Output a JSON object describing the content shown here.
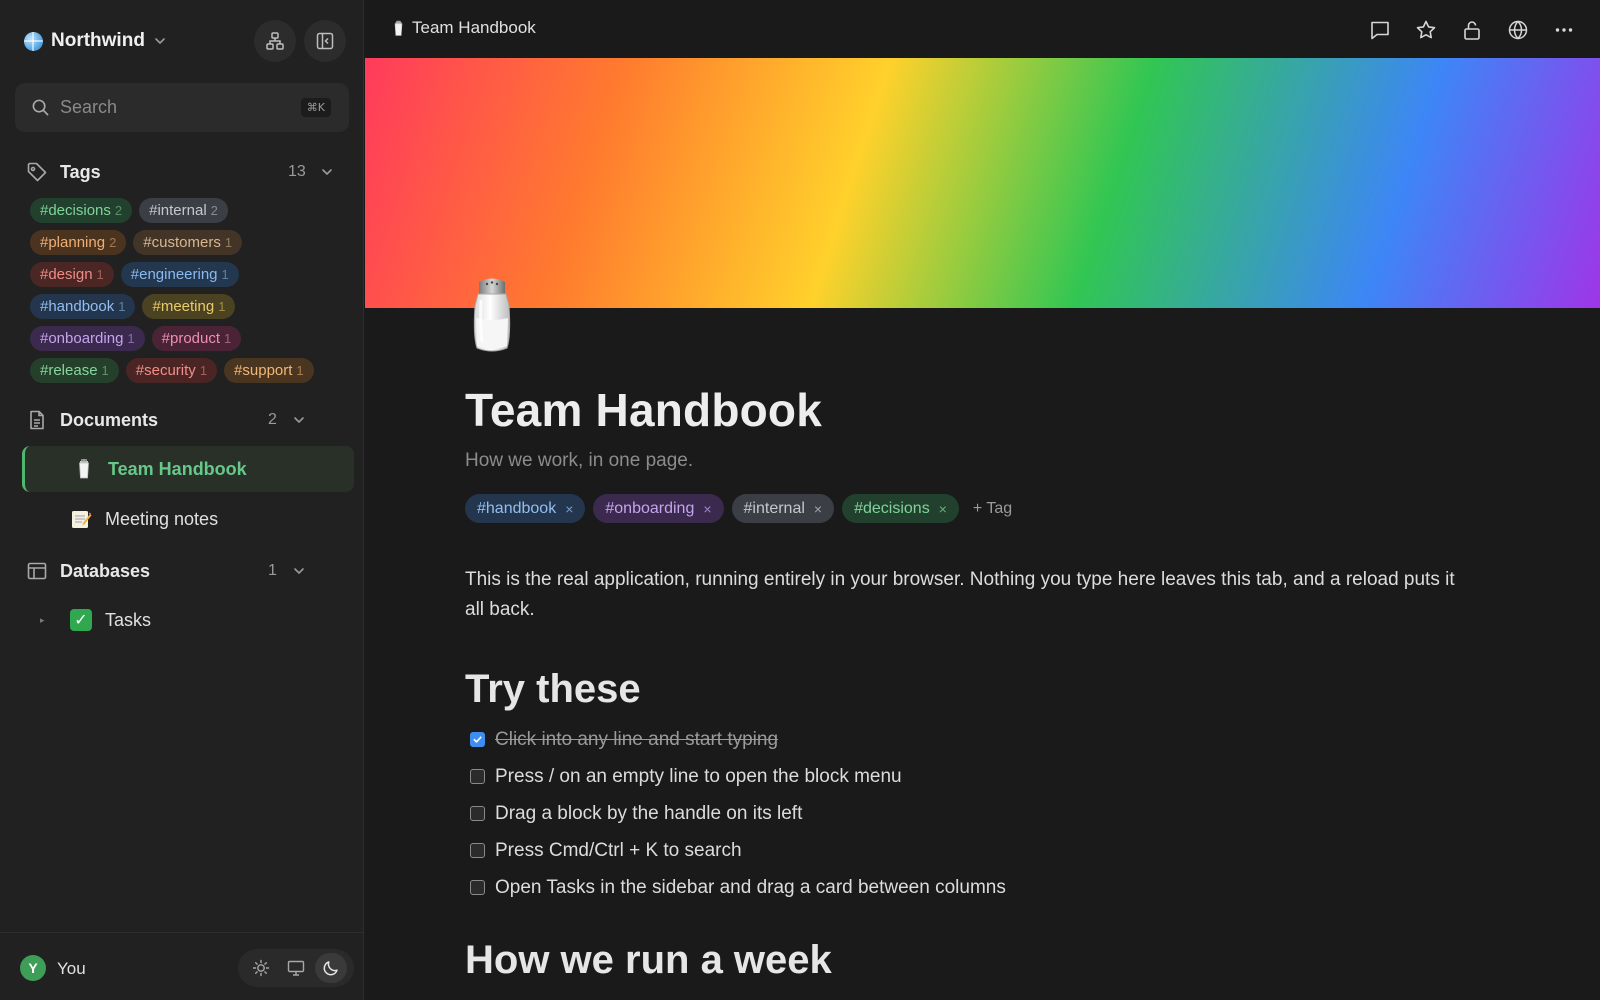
{
  "workspace": {
    "name": "Northwind"
  },
  "search": {
    "placeholder": "Search",
    "shortcut": "⌘K"
  },
  "tags_section": {
    "label": "Tags",
    "count": "13",
    "rows": [
      [
        {
          "name": "#decisions",
          "count": "2",
          "bg": "#22402e",
          "fg": "#7fd49a"
        },
        {
          "name": "#internal",
          "count": "2",
          "bg": "#3b3f45",
          "fg": "#c4c8ce"
        }
      ],
      [
        {
          "name": "#planning",
          "count": "2",
          "bg": "#4a3420",
          "fg": "#f0ae74"
        },
        {
          "name": "#customers",
          "count": "1",
          "bg": "#423528",
          "fg": "#d7b691"
        }
      ],
      [
        {
          "name": "#design",
          "count": "1",
          "bg": "#4a2624",
          "fg": "#f08c84"
        },
        {
          "name": "#engineering",
          "count": "1",
          "bg": "#23374f",
          "fg": "#8ab9ef"
        }
      ],
      [
        {
          "name": "#handbook",
          "count": "1",
          "bg": "#23364d",
          "fg": "#93bdf0"
        },
        {
          "name": "#meeting",
          "count": "1",
          "bg": "#4a4220",
          "fg": "#eacb6a"
        }
      ],
      [
        {
          "name": "#onboarding",
          "count": "1",
          "bg": "#3b2a4e",
          "fg": "#c6a3ee"
        },
        {
          "name": "#product",
          "count": "1",
          "bg": "#4a2436",
          "fg": "#ee8db7"
        }
      ],
      [
        {
          "name": "#release",
          "count": "1",
          "bg": "#24402b",
          "fg": "#88d49e"
        },
        {
          "name": "#security",
          "count": "1",
          "bg": "#4b2424",
          "fg": "#f08f8a"
        },
        {
          "name": "#support",
          "count": "1",
          "bg": "#4a3520",
          "fg": "#f0b877"
        }
      ]
    ]
  },
  "documents_section": {
    "label": "Documents",
    "count": "2",
    "items": [
      {
        "title": "Team Handbook",
        "icon": "salt-shaker-icon"
      },
      {
        "title": "Meeting notes",
        "icon": "memo-icon"
      }
    ]
  },
  "databases_section": {
    "label": "Databases",
    "count": "1",
    "items": [
      {
        "title": "Tasks",
        "icon": "check-mark-button-icon",
        "mark": "✓"
      }
    ]
  },
  "footer": {
    "user_initial": "Y",
    "user_name": "You",
    "theme_active": "dark"
  },
  "topbar": {
    "breadcrumb_title": "Team Handbook",
    "actions": [
      "comment-icon",
      "star-icon",
      "unlock-icon",
      "globe-icon",
      "more-icon"
    ]
  },
  "page": {
    "cover": "rainbow-gradient",
    "title": "Team Handbook",
    "subtitle": "How we work, in one page.",
    "tags": [
      {
        "name": "#handbook",
        "bg": "#23364d",
        "fg": "#93bdf0"
      },
      {
        "name": "#onboarding",
        "bg": "#3b2a4e",
        "fg": "#c6a3ee"
      },
      {
        "name": "#internal",
        "bg": "#3b3f45",
        "fg": "#c4c8ce"
      },
      {
        "name": "#decisions",
        "bg": "#22402e",
        "fg": "#7fd49a"
      }
    ],
    "tag_remove_glyph": "×",
    "add_tag_label": "+ Tag",
    "intro": "This is the real application, running entirely in your browser. Nothing you type here leaves this tab, and a reload puts it all back.",
    "heading_try": "Try these",
    "todos": [
      {
        "text": "Click into any line and start typing",
        "checked": true
      },
      {
        "text": "Press / on an empty line to open the block menu",
        "checked": false
      },
      {
        "text": "Drag a block by the handle on its left",
        "checked": false
      },
      {
        "text": "Press Cmd/Ctrl + K to search",
        "checked": false
      },
      {
        "text": "Open Tasks in the sidebar and drag a card between columns",
        "checked": false
      }
    ],
    "heading_week": "How we run a week"
  },
  "colors": {
    "accent_green": "#4fb870",
    "checkbox_blue": "#3d8ef0",
    "sidebar_bg": "#212121",
    "main_bg": "#1a1a1a"
  }
}
